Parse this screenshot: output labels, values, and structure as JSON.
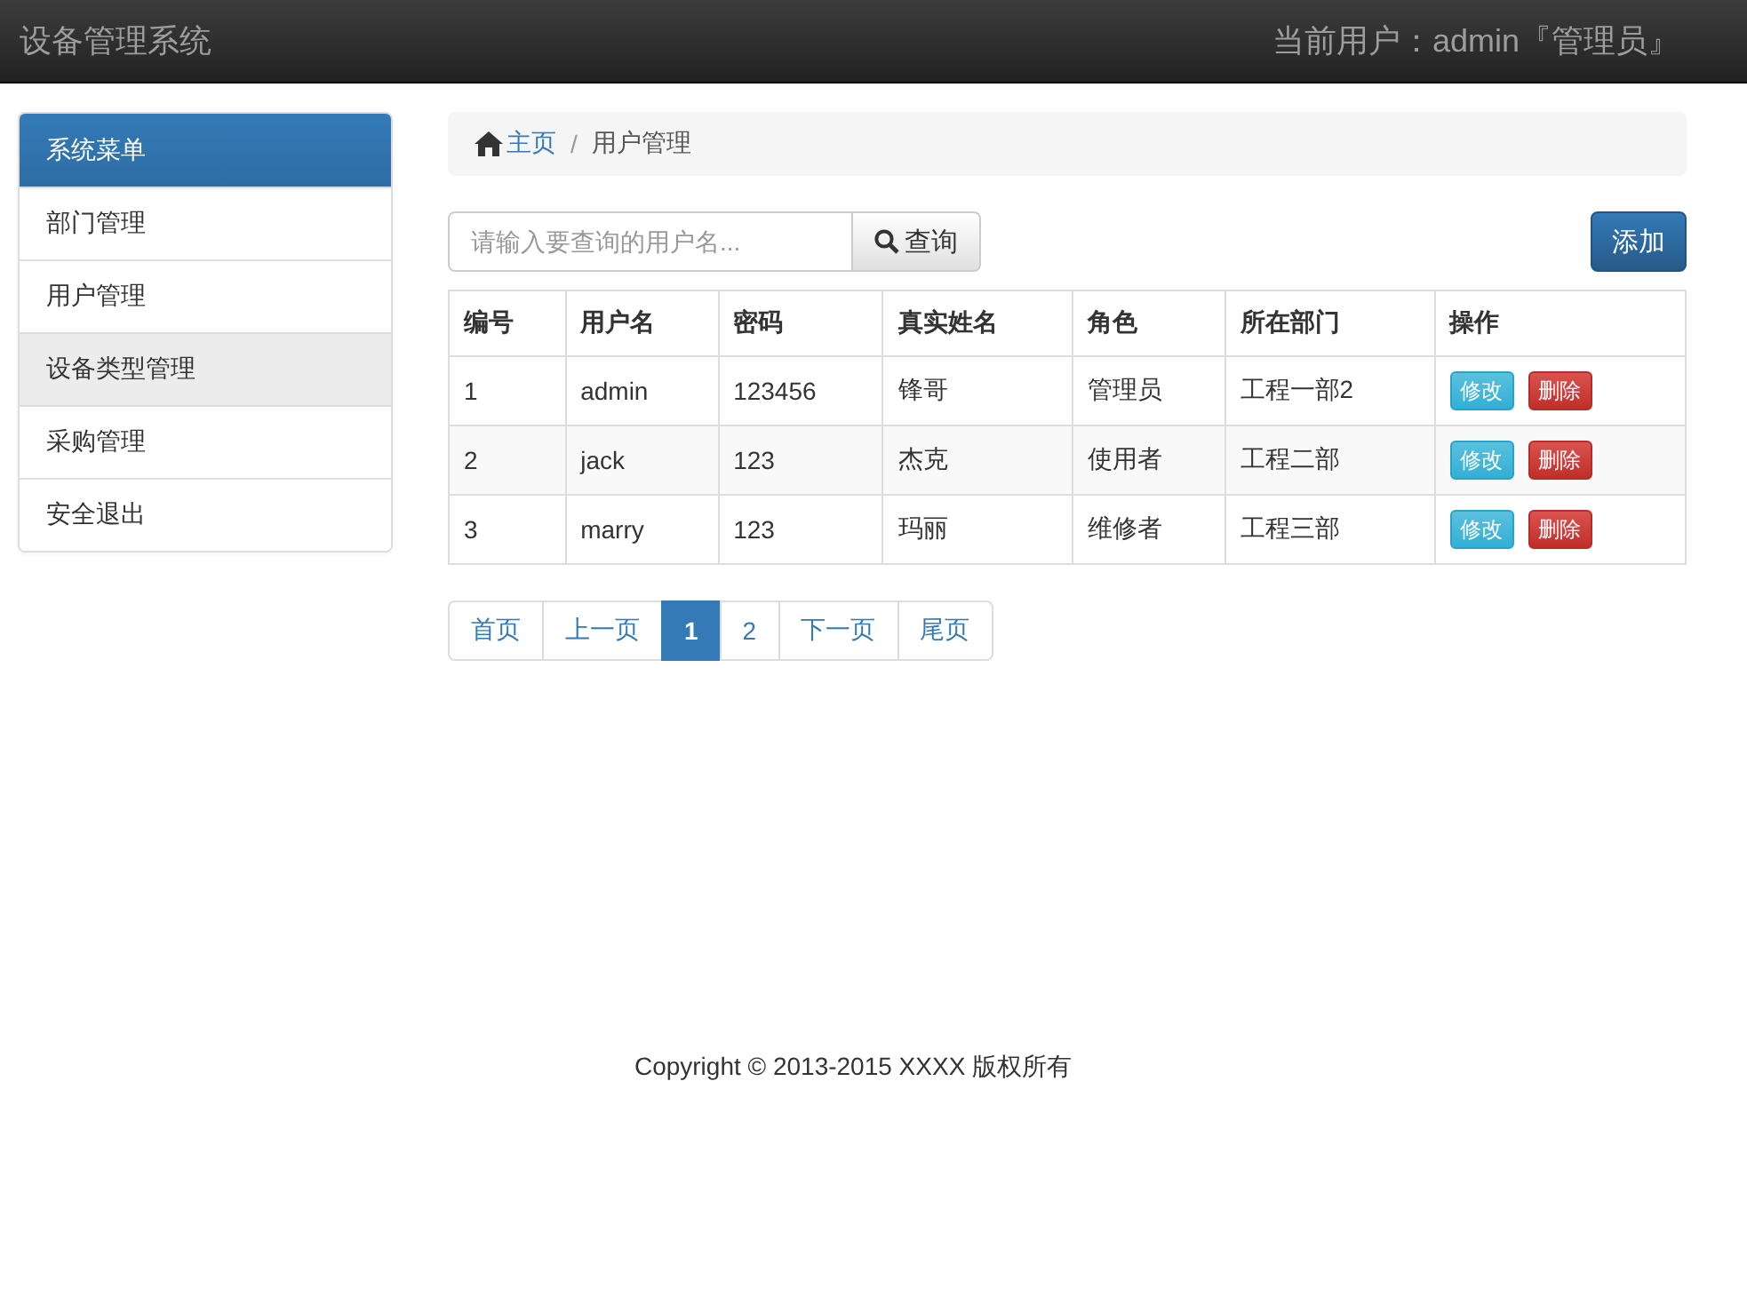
{
  "navbar": {
    "brand": "设备管理系统",
    "user": "当前用户：admin『管理员』"
  },
  "sidebar": {
    "title": "系统菜单",
    "items": [
      {
        "label": "部门管理",
        "selected": false
      },
      {
        "label": "用户管理",
        "selected": false
      },
      {
        "label": "设备类型管理",
        "selected": true
      },
      {
        "label": "采购管理",
        "selected": false
      },
      {
        "label": "安全退出",
        "selected": false
      }
    ]
  },
  "breadcrumb": {
    "home": "主页",
    "separator": "/",
    "current": "用户管理"
  },
  "search": {
    "placeholder": "请输入要查询的用户名...",
    "button": "查询"
  },
  "add_button": "添加",
  "table": {
    "columns": [
      "编号",
      "用户名",
      "密码",
      "真实姓名",
      "角色",
      "所在部门",
      "操作"
    ],
    "rows": [
      {
        "cells": [
          "1",
          "admin",
          "123456",
          "锋哥",
          "管理员",
          "工程一部2"
        ],
        "actions": [
          "修改",
          "删除"
        ]
      },
      {
        "cells": [
          "2",
          "jack",
          "123",
          "杰克",
          "使用者",
          "工程二部"
        ],
        "actions": [
          "修改",
          "删除"
        ]
      },
      {
        "cells": [
          "3",
          "marry",
          "123",
          "玛丽",
          "维修者",
          "工程三部"
        ],
        "actions": [
          "修改",
          "删除"
        ]
      }
    ]
  },
  "pagination": [
    {
      "label": "首页",
      "selected": false
    },
    {
      "label": "上一页",
      "selected": false
    },
    {
      "label": "1",
      "selected": true
    },
    {
      "label": "2",
      "selected": false
    },
    {
      "label": "下一页",
      "selected": false
    },
    {
      "label": "尾页",
      "selected": false
    }
  ],
  "footer": "Copyright © 2013-2015 XXXX 版权所有"
}
